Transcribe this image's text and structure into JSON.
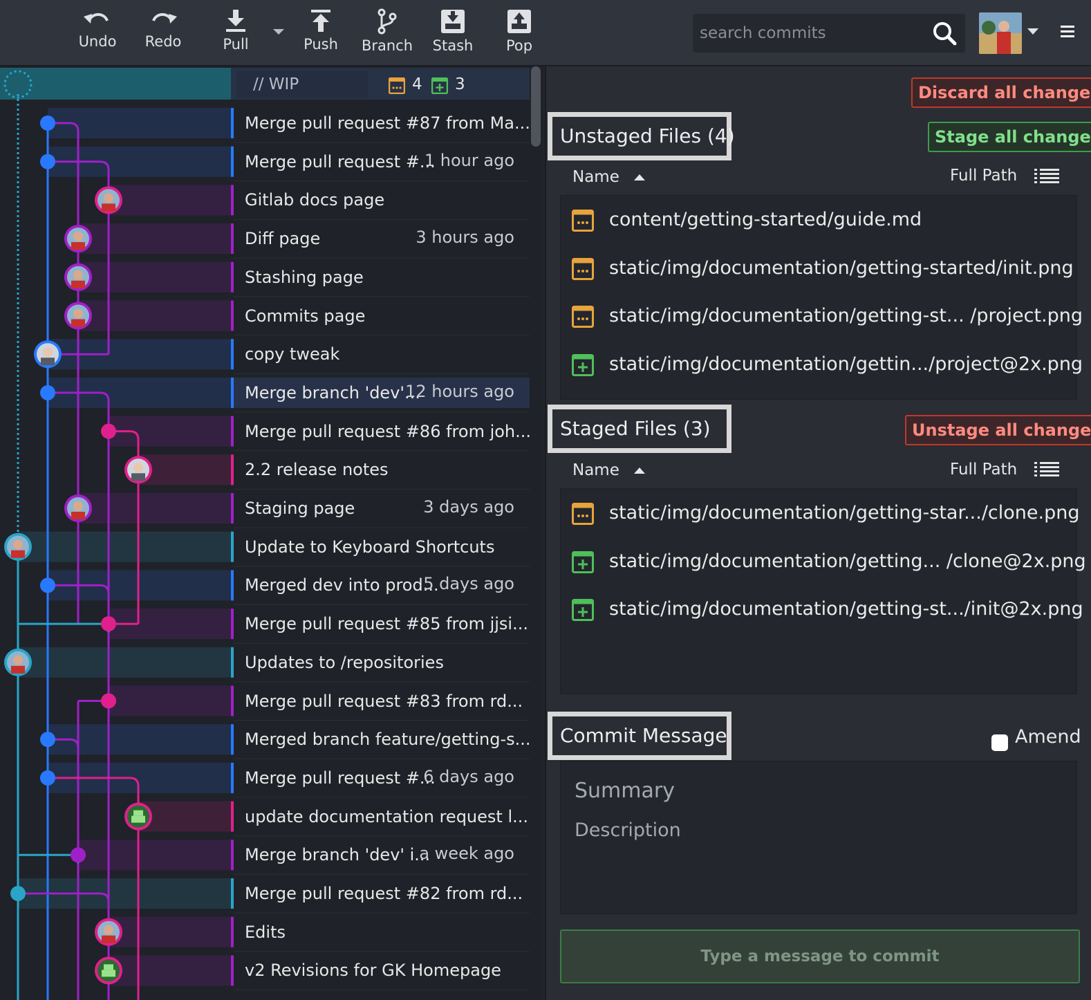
{
  "toolbar": {
    "undo_label": "Undo",
    "redo_label": "Redo",
    "pull_label": "Pull",
    "push_label": "Push",
    "branch_label": "Branch",
    "stash_label": "Stash",
    "pop_label": "Pop",
    "search_placeholder": "search commits"
  },
  "wip": {
    "label": "// WIP",
    "modified_count": "4",
    "added_count": "3"
  },
  "commits": [
    {
      "message": "Merge pull request #87 from Ma...",
      "time": ""
    },
    {
      "message": "Merge pull request #...",
      "time": "1 hour ago"
    },
    {
      "message": "Gitlab docs page",
      "time": ""
    },
    {
      "message": "Diff page",
      "time": "3 hours ago"
    },
    {
      "message": "Stashing page",
      "time": ""
    },
    {
      "message": "Commits page",
      "time": ""
    },
    {
      "message": "copy tweak",
      "time": ""
    },
    {
      "message": "Merge branch 'dev'...",
      "time": "12 hours ago"
    },
    {
      "message": "Merge pull request #86 from joh...",
      "time": ""
    },
    {
      "message": "2.2 release notes",
      "time": ""
    },
    {
      "message": "Staging page",
      "time": "3 days ago"
    },
    {
      "message": "Update to Keyboard Shortcuts",
      "time": ""
    },
    {
      "message": "Merged dev into prod...",
      "time": "5 days ago"
    },
    {
      "message": "Merge pull request #85 from jjsi...",
      "time": ""
    },
    {
      "message": "Updates to /repositories",
      "time": ""
    },
    {
      "message": "Merge pull request #83 from rd...",
      "time": ""
    },
    {
      "message": "Merged branch feature/getting-s...",
      "time": ""
    },
    {
      "message": "Merge pull request #...",
      "time": "6 days ago"
    },
    {
      "message": "update documentation request l...",
      "time": ""
    },
    {
      "message": "Merge branch 'dev' i...",
      "time": "a week ago"
    },
    {
      "message": "Merge pull request #82 from rd...",
      "time": ""
    },
    {
      "message": "Edits",
      "time": ""
    },
    {
      "message": "v2 Revisions for GK Homepage",
      "time": ""
    }
  ],
  "unstaged": {
    "title": "Unstaged Files (4)",
    "discard_label": "Discard all changes",
    "stage_all_label": "Stage all changes",
    "name_header": "Name",
    "path_header": "Full Path",
    "files": [
      {
        "status": "modified",
        "path": "content/getting-started/guide.md"
      },
      {
        "status": "modified",
        "path": "static/img/documentation/getting-started/init.png"
      },
      {
        "status": "modified",
        "path": "static/img/documentation/getting-st... /project.png"
      },
      {
        "status": "added",
        "path": "static/img/documentation/gettin.../project@2x.png"
      }
    ]
  },
  "staged": {
    "title": "Staged Files (3)",
    "unstage_all_label": "Unstage all changes",
    "name_header": "Name",
    "path_header": "Full Path",
    "files": [
      {
        "status": "modified",
        "path": "static/img/documentation/getting-star.../clone.png"
      },
      {
        "status": "added",
        "path": "static/img/documentation/getting... /clone@2x.png"
      },
      {
        "status": "added",
        "path": "static/img/documentation/getting-st.../init@2x.png"
      }
    ]
  },
  "commit": {
    "title": "Commit Message",
    "amend_label": "Amend",
    "summary_placeholder": "Summary",
    "description_placeholder": "Description",
    "button_label": "Type a message to commit"
  },
  "colors": {
    "blue": "#2979ff",
    "purple": "#a020c8",
    "magenta": "#e0208c",
    "teal": "#2aa4c8",
    "modified": "#e8a33c",
    "added": "#4fbf5a"
  }
}
